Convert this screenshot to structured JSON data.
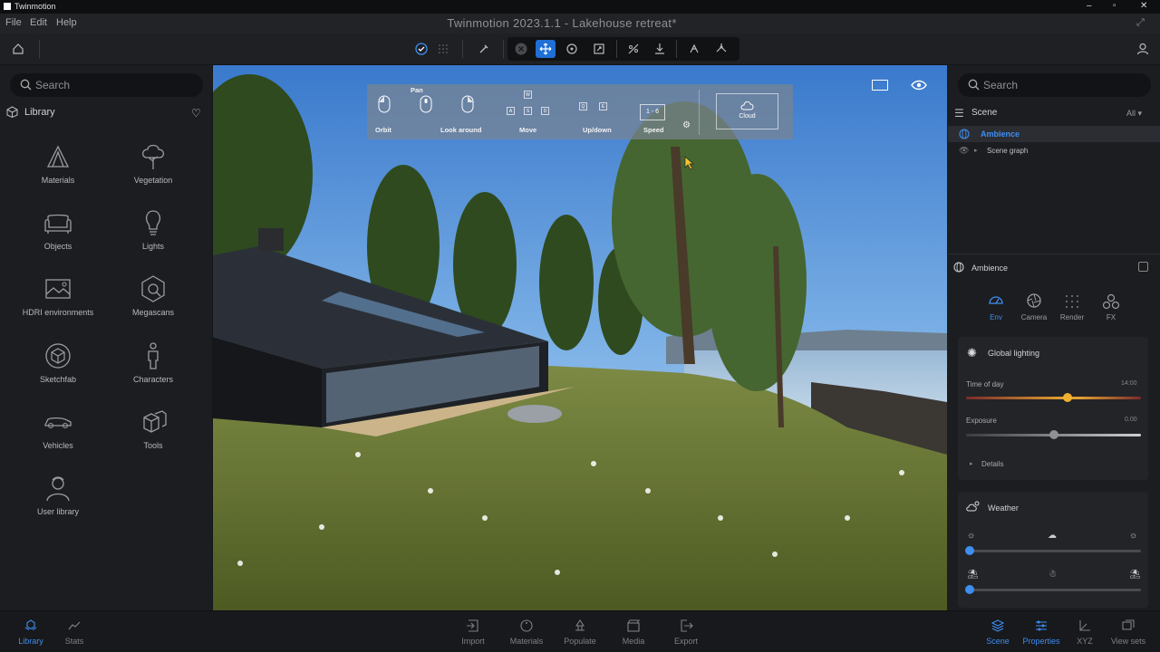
{
  "app": {
    "name": "Twinmotion",
    "document_title": "Twinmotion 2023.1.1 - Lakehouse retreat*"
  },
  "menu": [
    "File",
    "Edit",
    "Help"
  ],
  "toolbar": {
    "icons": [
      "home-icon",
      "check-circle-icon",
      "grid-dots-icon",
      "eyedropper-icon",
      "close-circle-icon",
      "move-icon",
      "rotate-icon",
      "scale-icon",
      "align-icon",
      "drop-to-floor-icon",
      "snap-icon",
      "pivot-icon",
      "user-icon"
    ]
  },
  "left_panel": {
    "search_placeholder": "Search",
    "library_title": "Library",
    "items": [
      {
        "label": "Materials",
        "icon": "materials-icon"
      },
      {
        "label": "Vegetation",
        "icon": "tree-icon"
      },
      {
        "label": "Objects",
        "icon": "sofa-icon"
      },
      {
        "label": "Lights",
        "icon": "bulb-icon"
      },
      {
        "label": "HDRI environments",
        "icon": "image-icon"
      },
      {
        "label": "Megascans",
        "icon": "megascans-icon"
      },
      {
        "label": "Sketchfab",
        "icon": "cube-icon"
      },
      {
        "label": "Characters",
        "icon": "person-icon"
      },
      {
        "label": "Vehicles",
        "icon": "car-icon"
      },
      {
        "label": "Tools",
        "icon": "tools-icon"
      },
      {
        "label": "User library",
        "icon": "user-icon"
      }
    ]
  },
  "nav_overlay": {
    "orbit": "Orbit",
    "pan": "Pan",
    "look_around": "Look around",
    "move": "Move",
    "updown": "Up/down",
    "speed": "Speed",
    "speed_keys": "1 - 6",
    "cloud": "Cloud",
    "keys": {
      "w": "W",
      "a": "A",
      "s": "S",
      "d": "D",
      "q": "Q",
      "e": "E"
    }
  },
  "right_panel": {
    "search_placeholder": "Search",
    "scene_title": "Scene",
    "scene_filter": "All",
    "tree": [
      {
        "label": "Ambience",
        "selected": true
      },
      {
        "label": "Scene graph",
        "selected": false
      }
    ],
    "ambience_title": "Ambience",
    "tabs": [
      {
        "label": "Env",
        "active": true
      },
      {
        "label": "Camera",
        "active": false
      },
      {
        "label": "Render",
        "active": false
      },
      {
        "label": "FX",
        "active": false
      }
    ],
    "global_lighting": {
      "title": "Global lighting",
      "time_label": "Time of day",
      "time_value": "14:00",
      "time_fraction": 0.58,
      "exposure_label": "Exposure",
      "exposure_value": "0.00",
      "exposure_fraction": 0.5,
      "details": "Details"
    },
    "weather": {
      "title": "Weather",
      "weather_fraction": 0.0,
      "season_fraction": 0.0
    }
  },
  "bottom_bar": {
    "left": [
      {
        "label": "Library",
        "active": true
      },
      {
        "label": "Stats",
        "active": false
      }
    ],
    "center": [
      {
        "label": "Import"
      },
      {
        "label": "Materials"
      },
      {
        "label": "Populate"
      },
      {
        "label": "Media"
      },
      {
        "label": "Export"
      }
    ],
    "right": [
      {
        "label": "Scene",
        "active": true
      },
      {
        "label": "Properties",
        "active": true
      },
      {
        "label": "XYZ",
        "active": false
      },
      {
        "label": "View sets",
        "active": false
      }
    ]
  },
  "colors": {
    "accent": "#3d8ef0",
    "panel": "#1c1d20",
    "sky": "#5b93d6",
    "grass": "#6b7a35"
  }
}
